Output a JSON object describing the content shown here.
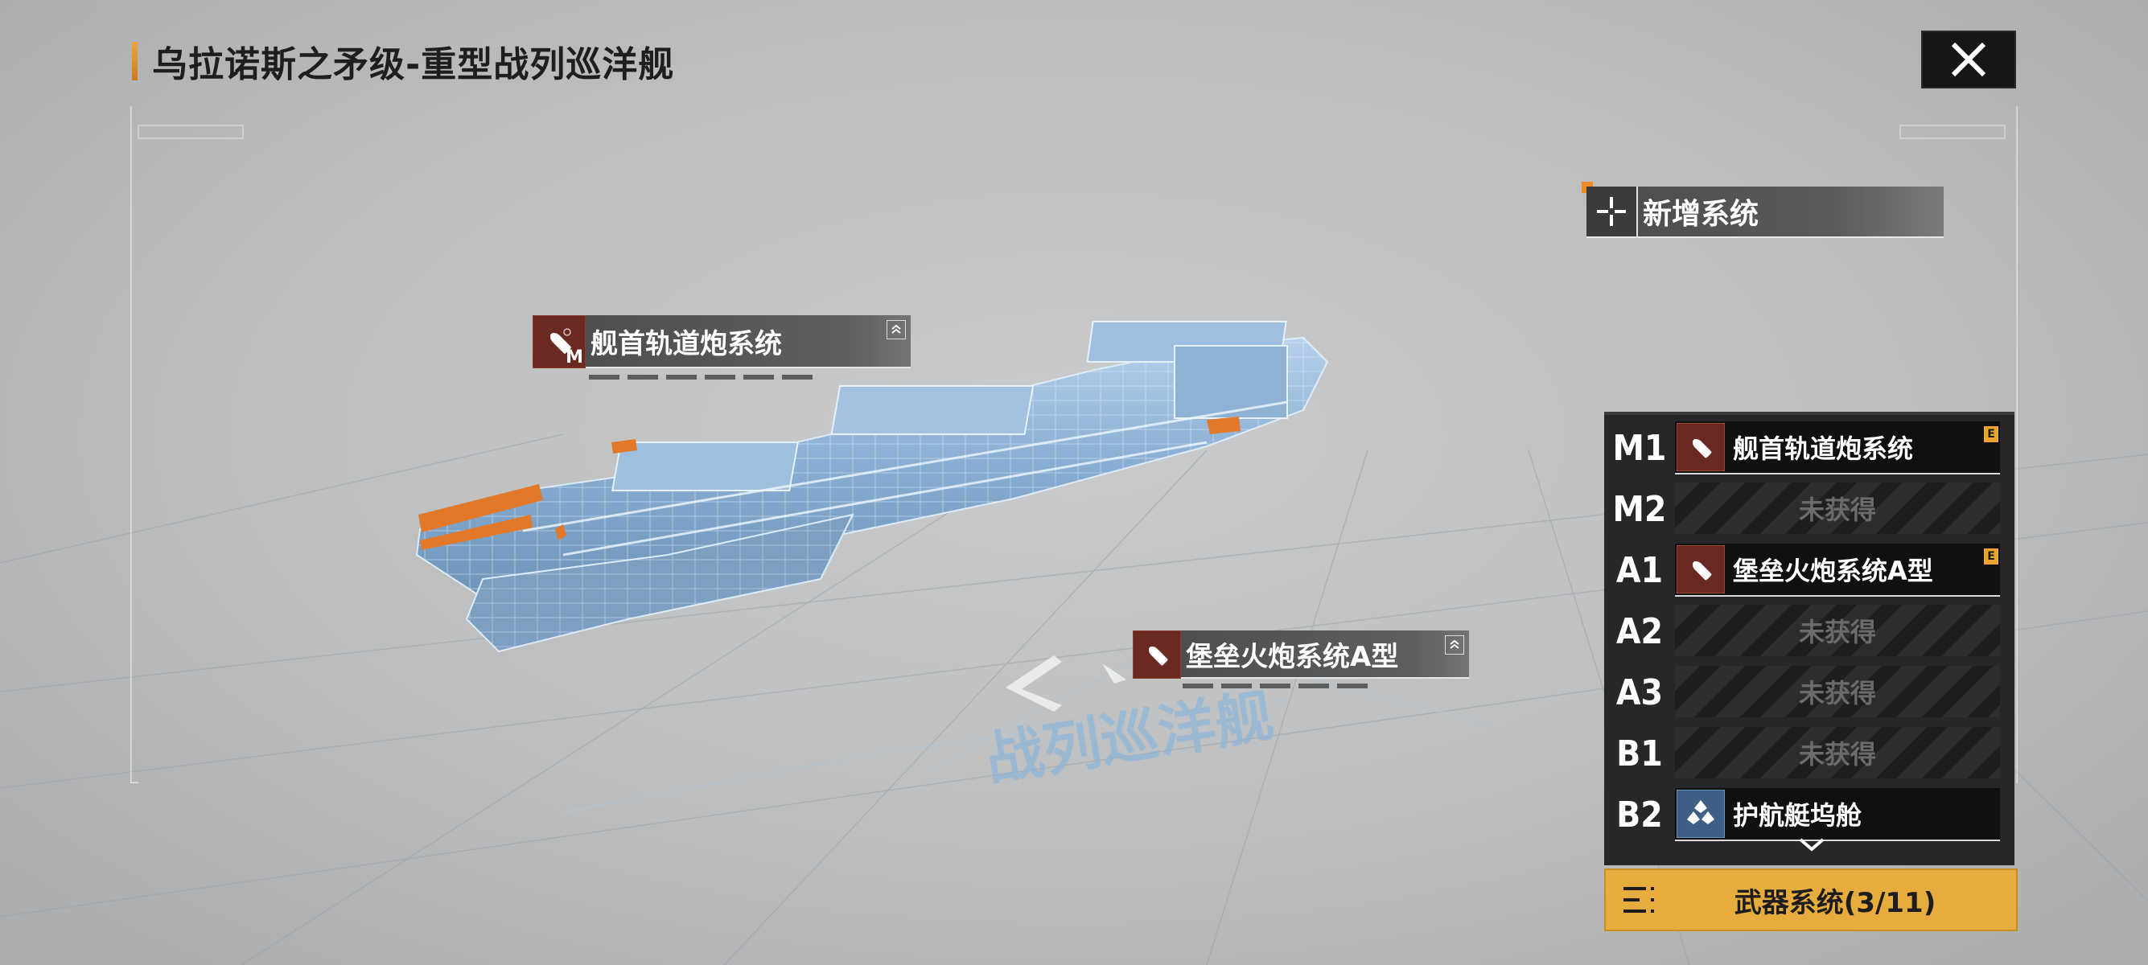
{
  "ship_title": "乌拉诺斯之矛级-重型战列巡洋舰",
  "watermark_text": "战列巡洋舰",
  "colors": {
    "accent_orange": "#f08a24",
    "footer_gold": "#e7ac3e",
    "panel_dark": "#262728",
    "weapon_icon_red": "#6a2a22",
    "support_icon_blue": "#3d5f86",
    "hologram_blue": "#8fb6dc"
  },
  "close_button": {
    "icon": "close-icon"
  },
  "add_system": {
    "label": "新增系统",
    "icon": "crosshair-plus-icon"
  },
  "callouts": [
    {
      "name": "舰首轨道炮系统",
      "badge_letter": "M",
      "icon": "shell-icon"
    },
    {
      "name": "堡垒火炮系统A型",
      "icon": "shell-icon"
    }
  ],
  "weapon_slots": [
    {
      "code": "M1",
      "status": "filled",
      "name": "舰首轨道炮系统",
      "icon": "shell-icon",
      "badge": "E"
    },
    {
      "code": "M2",
      "status": "empty",
      "name": "未获得"
    },
    {
      "code": "A1",
      "status": "filled",
      "name": "堡垒火炮系统A型",
      "icon": "shell-icon",
      "badge": "E"
    },
    {
      "code": "A2",
      "status": "empty",
      "name": "未获得"
    },
    {
      "code": "A3",
      "status": "empty",
      "name": "未获得"
    },
    {
      "code": "B1",
      "status": "empty",
      "name": "未获得"
    },
    {
      "code": "B2",
      "status": "filled",
      "name": "护航艇坞舱",
      "icon": "hangar-icon"
    }
  ],
  "weapon_footer": {
    "label": "武器系统(3/11)",
    "icon": "list-menu-icon"
  }
}
